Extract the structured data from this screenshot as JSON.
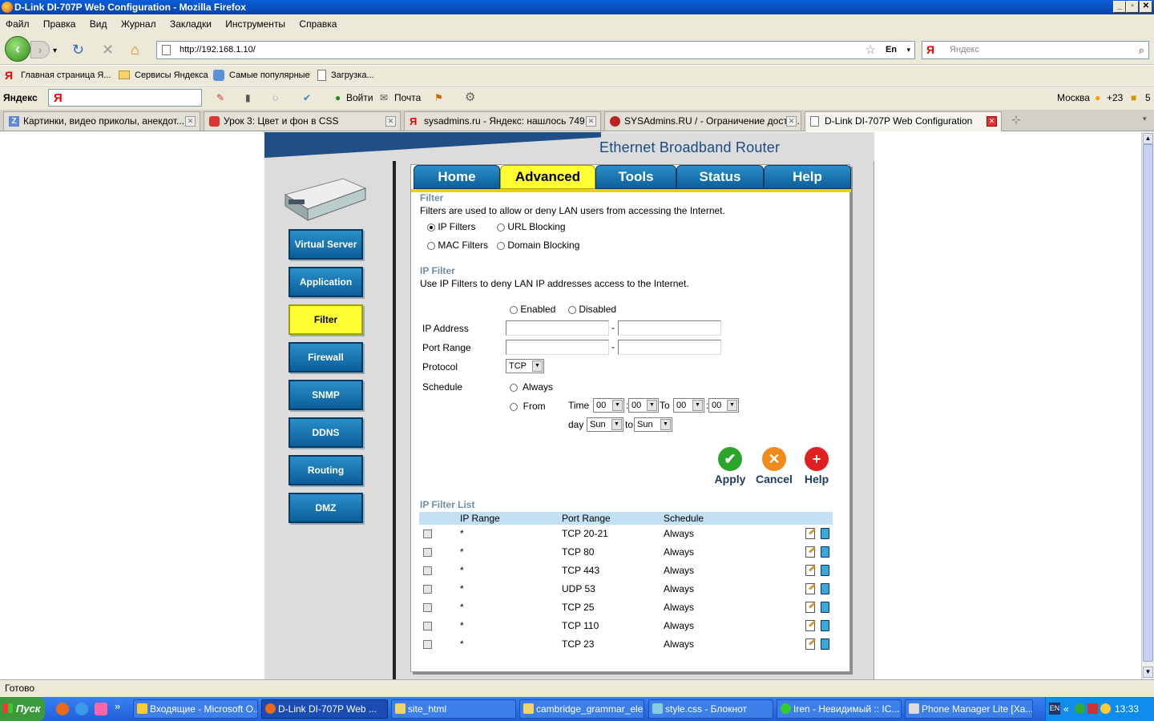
{
  "window": {
    "title": "D-Link DI-707P Web Configuration - Mozilla Firefox",
    "controls": [
      "_",
      "▫",
      "✕"
    ]
  },
  "menu": [
    "Файл",
    "Правка",
    "Вид",
    "Журнал",
    "Закладки",
    "Инструменты",
    "Справка"
  ],
  "nav": {
    "url": "http://192.168.1.10/",
    "search_placeholder": "Яндекс",
    "search_engine": "Я",
    "lang_badge": "En"
  },
  "bookmarks": [
    "Главная страница Я...",
    "Сервисы Яндекса",
    "Самые популярные",
    "Загрузка..."
  ],
  "yandex_bar": {
    "brand": "Яндекс",
    "login": "Войти",
    "mail": "Почта",
    "city": "Москва",
    "temp": "+23",
    "count": "5"
  },
  "tabs": [
    {
      "label": "Картинки, видео приколы, анекдот...",
      "active": false
    },
    {
      "label": "Урок 3: Цвет и фон в CSS",
      "active": false
    },
    {
      "label": "sysadmins.ru - Яндекс: нашлось 749 ...",
      "active": false
    },
    {
      "label": "SYSAdmins.RU / - Ограничение досту...",
      "active": false
    },
    {
      "label": "D-Link DI-707P Web Configuration",
      "active": true
    }
  ],
  "router": {
    "product": "Ethernet Broadband Router",
    "top_nav": [
      "Home",
      "Advanced",
      "Tools",
      "Status",
      "Help"
    ],
    "active_top": "Advanced",
    "left_nav": [
      "Virtual Server",
      "Application",
      "Filter",
      "Firewall",
      "SNMP",
      "DDNS",
      "Routing",
      "DMZ"
    ],
    "active_left": "Filter",
    "filter": {
      "title": "Filter",
      "desc": "Filters are used to allow or deny LAN users from accessing the Internet.",
      "options": [
        "IP Filters",
        "URL Blocking",
        "MAC Filters",
        "Domain Blocking"
      ],
      "selected": "IP Filters"
    },
    "ip_filter": {
      "title": "IP Filter",
      "desc": "Use IP Filters to deny LAN IP addresses access to the Internet.",
      "enabled_label": "Enabled",
      "disabled_label": "Disabled",
      "ip_address_label": "IP Address",
      "port_range_label": "Port Range",
      "protocol_label": "Protocol",
      "protocol_value": "TCP",
      "schedule_label": "Schedule",
      "always_label": "Always",
      "from_label": "From",
      "time_label": "Time",
      "to_label": "To",
      "day_label": "day",
      "to_small": "to",
      "hh1": "00",
      "mm1": "00",
      "hh2": "00",
      "mm2": "00",
      "day_from": "Sun",
      "day_to": "Sun",
      "dash": "-",
      "colon": ":"
    },
    "actions": {
      "apply": "Apply",
      "cancel": "Cancel",
      "help": "Help"
    },
    "list": {
      "title": "IP Filter List",
      "headers": [
        "IP Range",
        "Port Range",
        "Schedule"
      ],
      "rows": [
        {
          "ip": "*",
          "port": "TCP 20-21",
          "schedule": "Always"
        },
        {
          "ip": "*",
          "port": "TCP 80",
          "schedule": "Always"
        },
        {
          "ip": "*",
          "port": "TCP 443",
          "schedule": "Always"
        },
        {
          "ip": "*",
          "port": "UDP 53",
          "schedule": "Always"
        },
        {
          "ip": "*",
          "port": "TCP 25",
          "schedule": "Always"
        },
        {
          "ip": "*",
          "port": "TCP 110",
          "schedule": "Always"
        },
        {
          "ip": "*",
          "port": "TCP 23",
          "schedule": "Always"
        }
      ]
    }
  },
  "status": "Готово",
  "taskbar": {
    "start": "Пуск",
    "items": [
      {
        "label": "Входящие - Microsoft O...",
        "active": false
      },
      {
        "label": "D-Link DI-707P Web ...",
        "active": true
      },
      {
        "label": "site_html",
        "active": false
      },
      {
        "label": "cambridge_grammar_ele...",
        "active": false
      },
      {
        "label": "style.css - Блокнот",
        "active": false
      },
      {
        "label": "Iren - Невидимый :: IC...",
        "active": false
      },
      {
        "label": "Phone Manager Lite  [Xa...",
        "active": false
      }
    ],
    "lang": "EN",
    "clock": "13:33"
  }
}
